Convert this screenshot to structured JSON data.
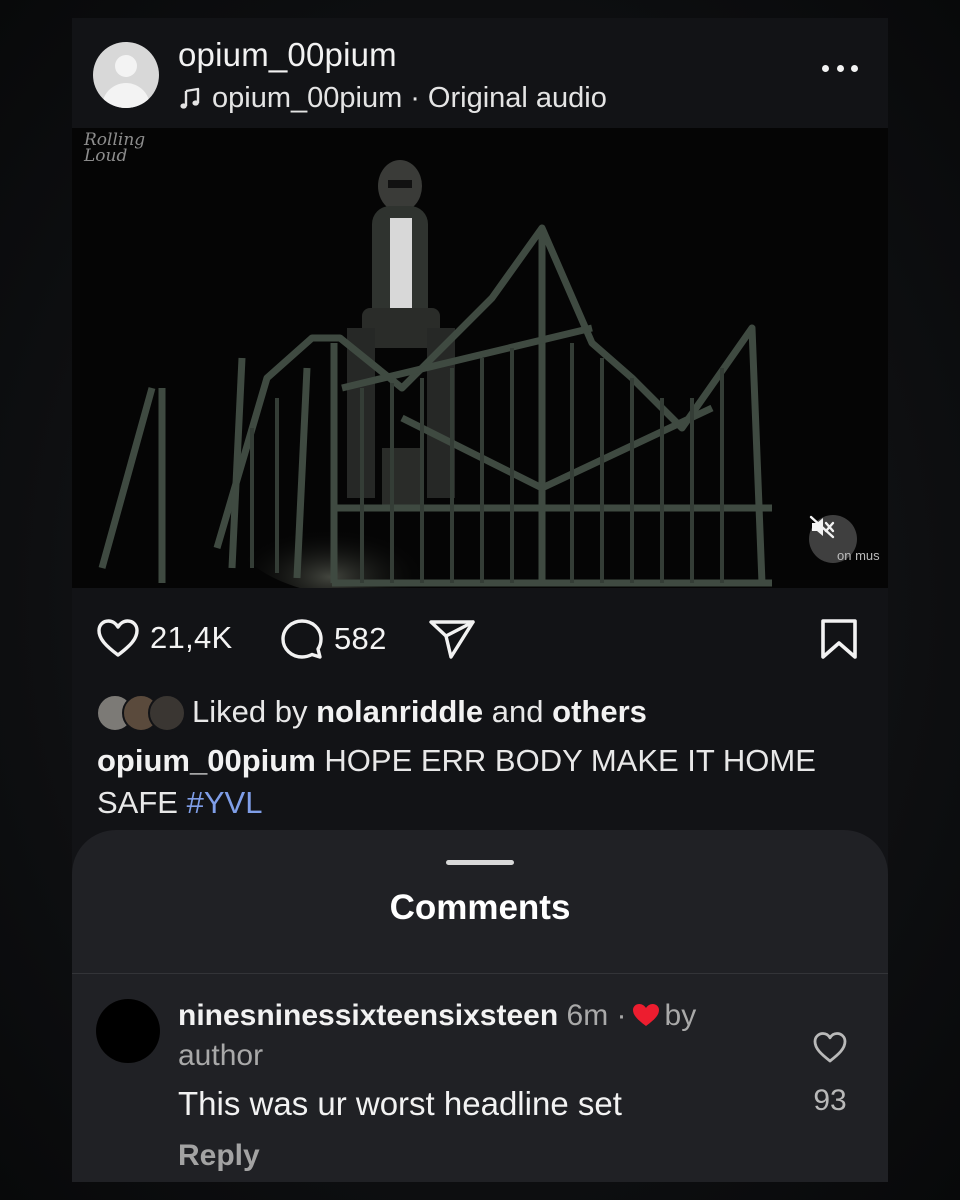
{
  "post": {
    "username": "opium_00pium",
    "audio_owner": "opium_00pium",
    "audio_separator": "·",
    "audio_label": "Original audio",
    "more_icon": "more-horizontal-icon"
  },
  "media": {
    "watermark_line1": "Rolling",
    "watermark_line2": "Loud",
    "corner_text": "on mus",
    "mute_icon": "speaker-muted-icon"
  },
  "actions": {
    "likes": "21,4K",
    "comments": "582",
    "like_icon": "heart-outline-icon",
    "comment_icon": "comment-bubble-icon",
    "share_icon": "send-paper-plane-icon",
    "save_icon": "bookmark-icon"
  },
  "liked_by": {
    "prefix": "Liked by",
    "user": "nolanriddle",
    "and": "and",
    "others": "others"
  },
  "caption": {
    "user": "opium_00pium",
    "text": "HOPE ERR BODY MAKE IT HOME SAFE",
    "hashtag": "#YVL"
  },
  "comments_sheet": {
    "title": "Comments",
    "items": [
      {
        "user": "ninesninessixteensixsteen",
        "time": "6m",
        "separator": "·",
        "by": "by",
        "author": "author",
        "text": "This was ur worst headline set",
        "reply": "Reply",
        "likes": "93"
      }
    ]
  },
  "colors": {
    "background": "#121316",
    "sheet": "#202125",
    "hashtag": "#7f9ee8",
    "heart_red": "#ed1d2f"
  }
}
